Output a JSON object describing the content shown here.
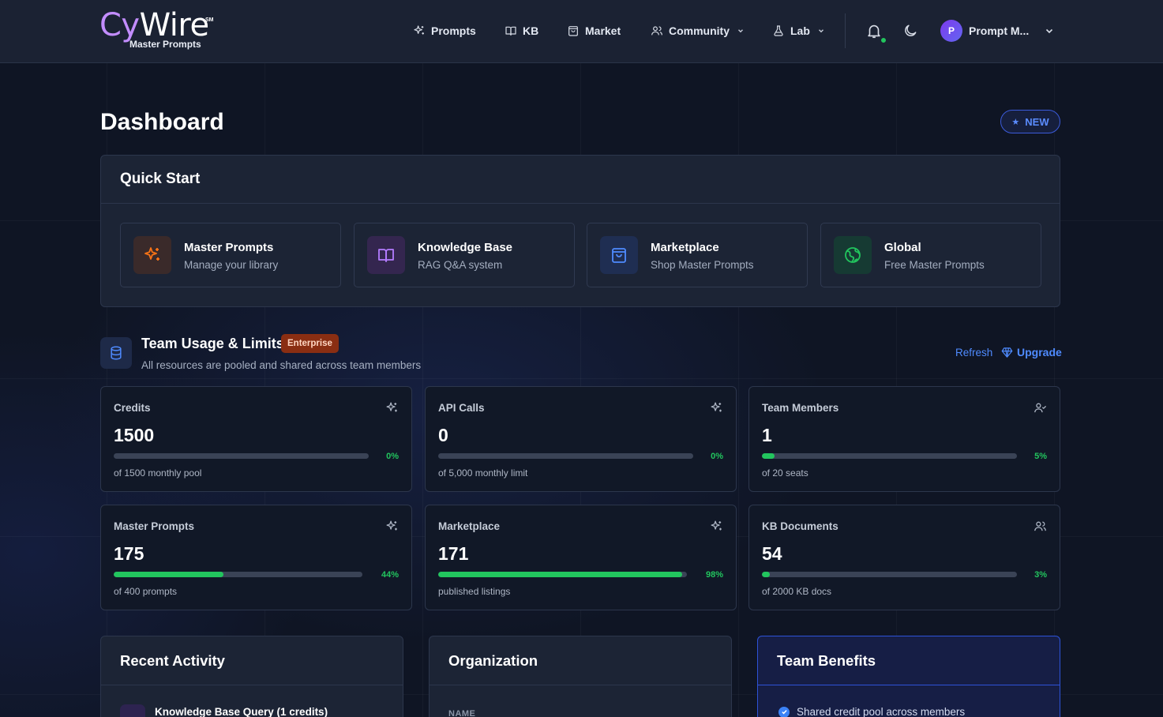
{
  "brand": {
    "name_part1": "Cy",
    "name_part2": "Wire",
    "mark": "SM",
    "tagline": "Master Prompts",
    "accent": "#c38dff"
  },
  "nav": {
    "items": [
      {
        "label": "Prompts",
        "icon": "sparkles-icon"
      },
      {
        "label": "KB",
        "icon": "book-icon"
      },
      {
        "label": "Market",
        "icon": "shopping-bag-icon"
      },
      {
        "label": "Community",
        "icon": "users-icon",
        "dropdown": true
      },
      {
        "label": "Lab",
        "icon": "flask-icon",
        "dropdown": true
      }
    ],
    "notification_dot_color": "#22c55e",
    "user": {
      "initial": "P",
      "name": "Prompt M..."
    }
  },
  "page": {
    "title": "Dashboard",
    "badge": "NEW"
  },
  "quick_start": {
    "title": "Quick Start",
    "cards": [
      {
        "title": "Master Prompts",
        "subtitle": "Manage your library",
        "icon": "sparkles-icon",
        "color": "#f97316"
      },
      {
        "title": "Knowledge Base",
        "subtitle": "RAG Q&A system",
        "icon": "book-open-icon",
        "color": "#a855f7"
      },
      {
        "title": "Marketplace",
        "subtitle": "Shop Master Prompts",
        "icon": "shopping-bag-icon",
        "color": "#3b82f6"
      },
      {
        "title": "Global",
        "subtitle": "Free Master Prompts",
        "icon": "globe-icon",
        "color": "#22c55e"
      }
    ]
  },
  "usage": {
    "title": "Team Usage & Limits",
    "plan_badge": "Enterprise",
    "subtitle": "All resources are pooled and shared across team members",
    "refresh_label": "Refresh",
    "upgrade_label": "Upgrade",
    "stats": [
      {
        "label": "Credits",
        "value": "1500",
        "percent": 0,
        "percent_label": "0%",
        "note": "of 1500 monthly pool",
        "icon": "sparkles-icon"
      },
      {
        "label": "API Calls",
        "value": "0",
        "percent": 0,
        "percent_label": "0%",
        "note": "of 5,000 monthly limit",
        "icon": "sparkles-icon"
      },
      {
        "label": "Team Members",
        "value": "1",
        "percent": 5,
        "percent_label": "5%",
        "note": "of 20 seats",
        "icon": "user-check-icon"
      },
      {
        "label": "Master Prompts",
        "value": "175",
        "percent": 44,
        "percent_label": "44%",
        "note": "of 400 prompts",
        "icon": "sparkles-icon"
      },
      {
        "label": "Marketplace",
        "value": "171",
        "percent": 98,
        "percent_label": "98%",
        "note": "published listings",
        "icon": "sparkles-icon"
      },
      {
        "label": "KB Documents",
        "value": "54",
        "percent": 3,
        "percent_label": "3%",
        "note": "of 2000 KB docs",
        "icon": "users-icon"
      }
    ]
  },
  "recent_activity": {
    "title": "Recent Activity",
    "items": [
      {
        "text": "Knowledge Base Query (1 credits)"
      }
    ]
  },
  "organization": {
    "title": "Organization",
    "name_label": "NAME"
  },
  "team_benefits": {
    "title": "Team Benefits",
    "items": [
      "Shared credit pool across members"
    ]
  }
}
